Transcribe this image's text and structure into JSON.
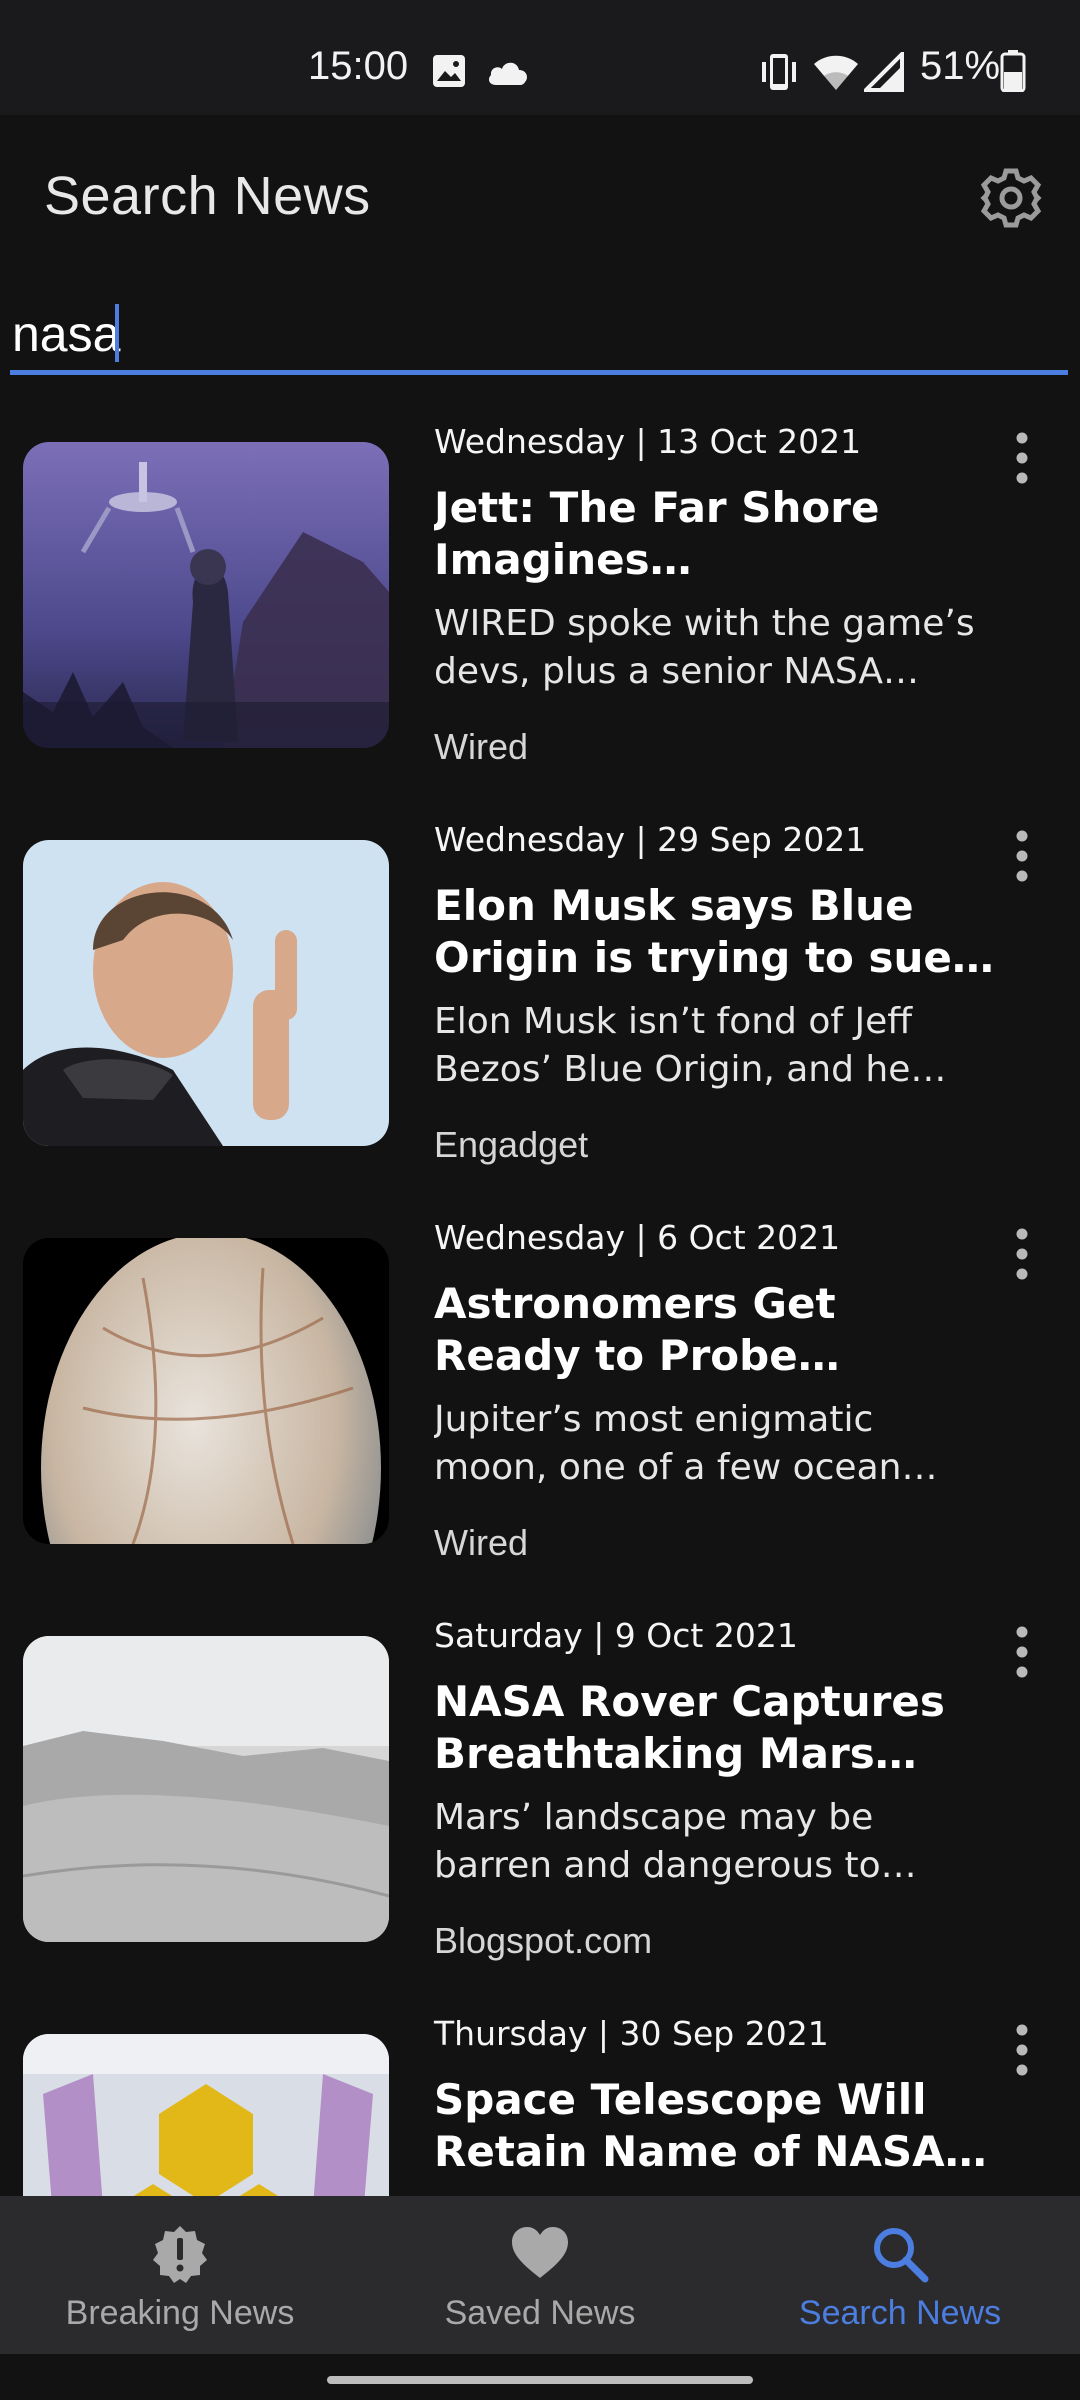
{
  "status_bar": {
    "time": "15:00",
    "battery": "51%",
    "icons": [
      "image-icon",
      "cloud-icon",
      "vibrate-icon",
      "wifi-icon",
      "signal-icon",
      "battery-icon"
    ]
  },
  "app_bar": {
    "title": "Search News",
    "settings_icon": "gear-icon"
  },
  "search": {
    "value": "nasa",
    "accent": "#4b7ee0"
  },
  "articles": [
    {
      "date": "Wednesday | 13 Oct 2021",
      "title": "Jett: The Far Shore Imagines Conscientious Space Coloniz…",
      "description": "WIRED spoke with the game’s devs, plus a senior NASA astr…",
      "source": "Wired"
    },
    {
      "date": "Wednesday | 29 Sep 2021",
      "title": "Elon Musk says Blue Origin is trying to sue its way to the …",
      "description": "Elon Musk isn’t fond of Jeff Bezos’ Blue Origin, and he just…",
      "source": "Engadget"
    },
    {
      "date": "Wednesday | 6 Oct 2021",
      "title": "Astronomers Get Ready to Probe Europa’s Hidden Ocea…",
      "description": "Jupiter’s most enigmatic moon, one of a few ocean worlds in t…",
      "source": "Wired"
    },
    {
      "date": "Saturday | 9 Oct 2021",
      "title": "NASA Rover Captures Breathtaking Mars Landsca…",
      "description": "Mars’ landscape may be barren and dangerous to human life, …",
      "source": "Blogspot.com"
    },
    {
      "date": "Thursday | 30 Sep 2021",
      "title": "Space Telescope Will Retain Name of NASA Administrato…",
      "description": "",
      "source": ""
    }
  ],
  "bottom_nav": [
    {
      "label": "Breaking News",
      "icon": "alert-badge-icon",
      "active": false
    },
    {
      "label": "Saved News",
      "icon": "heart-icon",
      "active": false
    },
    {
      "label": "Search News",
      "icon": "search-icon",
      "active": true
    }
  ]
}
